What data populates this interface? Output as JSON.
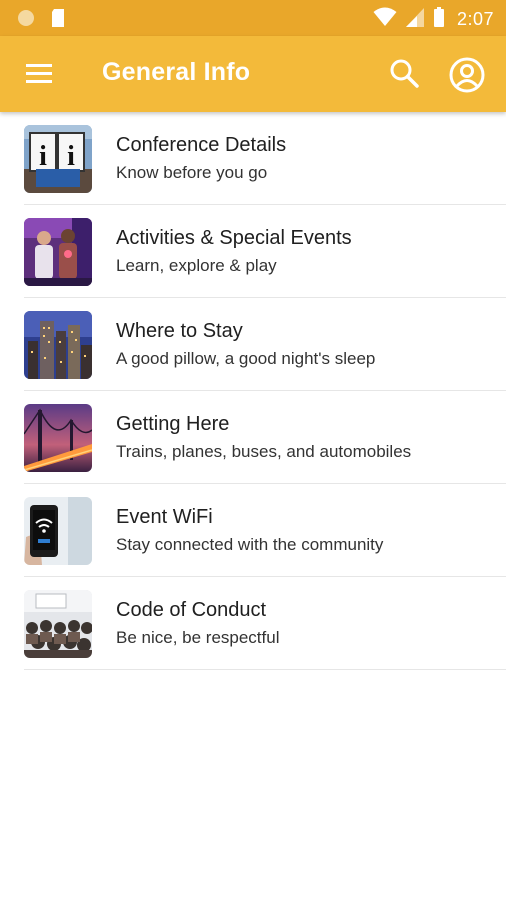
{
  "status_bar": {
    "time": "2:07",
    "icons": [
      "circle-notification-icon",
      "sd-card-icon",
      "wifi-icon",
      "cell-signal-icon",
      "battery-icon"
    ]
  },
  "app_bar": {
    "title": "General Info",
    "color": "#f3ba3a",
    "status_color": "#e9a72a",
    "icons": [
      "menu-icon",
      "search-icon",
      "account-icon"
    ]
  },
  "items": [
    {
      "title": "Conference Details",
      "subtitle": "Know before you go",
      "icon": "info-sign-thumbnail"
    },
    {
      "title": "Activities & Special Events",
      "subtitle": "Learn, explore & play",
      "icon": "people-photo-thumbnail"
    },
    {
      "title": "Where to Stay",
      "subtitle": "A good pillow, a good night's sleep",
      "icon": "city-skyline-thumbnail"
    },
    {
      "title": "Getting Here",
      "subtitle": "Trains, planes, buses, and automobiles",
      "icon": "bridge-photo-thumbnail"
    },
    {
      "title": "Event WiFi",
      "subtitle": "Stay connected with the community",
      "icon": "phone-wifi-thumbnail"
    },
    {
      "title": "Code of Conduct",
      "subtitle": "Be nice, be respectful",
      "icon": "audience-photo-thumbnail"
    }
  ]
}
